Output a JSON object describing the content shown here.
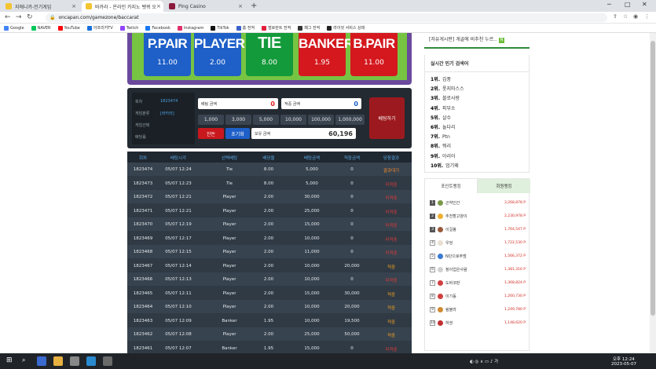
{
  "browser": {
    "tabs": [
      {
        "label": "지애니카-인기게임",
        "active": false,
        "color": "#f4c430"
      },
      {
        "label": "바카라 - 온라인 카지노 벳퀴 오",
        "active": true,
        "color": "#f4c430"
      },
      {
        "label": "Ping Casino",
        "active": false,
        "color": "#8b1a3c"
      }
    ],
    "url": "oncapan.com/gamezone/baccarat",
    "bookmarks": [
      {
        "label": "Google",
        "color": "#4285f4"
      },
      {
        "label": "NAVER",
        "color": "#03c75a"
      },
      {
        "label": "YouTube",
        "color": "#ff0000"
      },
      {
        "label": "아프리카TV",
        "color": "#1a6fd8"
      },
      {
        "label": "Twitch",
        "color": "#9146ff"
      },
      {
        "label": "Facebook",
        "color": "#1877f2"
      },
      {
        "label": "Instagram",
        "color": "#e1306c"
      },
      {
        "label": "TikTok",
        "color": "#111111"
      },
      {
        "label": "홈 전적",
        "color": "#3a63c8"
      },
      {
        "label": "벌로란트 전적",
        "color": "#e0203a"
      },
      {
        "label": "페그 전적",
        "color": "#333333"
      },
      {
        "label": "라이엇 서비스 상태",
        "color": "#222222"
      }
    ]
  },
  "bet_options": [
    {
      "name": "P.PAIR",
      "odds": "11.00",
      "color": "#1e5fc8"
    },
    {
      "name": "PLAYER",
      "odds": "2.00",
      "color": "#1e5fc8"
    },
    {
      "name": "TIE",
      "odds": "8.00",
      "color": "#139a3a"
    },
    {
      "name": "BANKER",
      "odds": "1.95",
      "color": "#d4181e"
    },
    {
      "name": "B.PAIR",
      "odds": "11.00",
      "color": "#d4181e"
    }
  ],
  "game_info": {
    "round_label": "회차",
    "round_value": "1823474",
    "type_label": "게임분류",
    "type_value": "[바카라]",
    "choice_label": "게임선택",
    "odds_label": "배당률"
  },
  "bet_panel": {
    "bet_amount_label": "베팅 금액",
    "bet_amount_value": "0",
    "win_amount_label": "적중 금액",
    "win_amount_value": "0",
    "chips": [
      "1,000",
      "3,000",
      "5,000",
      "10,000",
      "100,000",
      "1,000,000"
    ],
    "reset_label": "잔돈",
    "clear_label": "초기화",
    "balance_label": "보유 금액",
    "balance_value": "60,196",
    "submit_label": "베팅하기"
  },
  "history": {
    "headers": [
      "회차",
      "베팅시각",
      "선택베팅",
      "배당율",
      "베팅금액",
      "적중금액",
      "당첨결과"
    ],
    "rows": [
      [
        "1823474",
        "05/07 12:24",
        "Tie",
        "8.00",
        "5,000",
        "0",
        "결과대기",
        "wait"
      ],
      [
        "1823473",
        "05/07 12:23",
        "Tie",
        "8.00",
        "5,000",
        "0",
        "미적중",
        "lose"
      ],
      [
        "1823472",
        "05/07 12:21",
        "Player",
        "2.00",
        "30,000",
        "0",
        "미적중",
        "lose"
      ],
      [
        "1823471",
        "05/07 12:21",
        "Player",
        "2.00",
        "25,000",
        "0",
        "미적중",
        "lose"
      ],
      [
        "1823470",
        "05/07 12:19",
        "Player",
        "2.00",
        "15,000",
        "0",
        "미적중",
        "lose"
      ],
      [
        "1823469",
        "05/07 12:17",
        "Player",
        "2.00",
        "10,000",
        "0",
        "미적중",
        "lose"
      ],
      [
        "1823468",
        "05/07 12:15",
        "Player",
        "2.00",
        "11,000",
        "0",
        "미적중",
        "lose"
      ],
      [
        "1823467",
        "05/07 12:14",
        "Player",
        "2.00",
        "10,000",
        "20,000",
        "적중",
        "win"
      ],
      [
        "1823466",
        "05/07 12:13",
        "Player",
        "2.00",
        "10,000",
        "0",
        "미적중",
        "lose"
      ],
      [
        "1823465",
        "05/07 12:11",
        "Player",
        "2.00",
        "15,000",
        "30,000",
        "적중",
        "win"
      ],
      [
        "1823464",
        "05/07 12:10",
        "Player",
        "2.00",
        "10,000",
        "20,000",
        "적중",
        "win"
      ],
      [
        "1823463",
        "05/07 12:09",
        "Banker",
        "1.95",
        "10,000",
        "19,500",
        "적중",
        "win"
      ],
      [
        "1823462",
        "05/07 12:08",
        "Player",
        "2.00",
        "25,000",
        "50,000",
        "적중",
        "win"
      ],
      [
        "1823461",
        "05/07 12:07",
        "Banker",
        "1.95",
        "15,000",
        "0",
        "미적중",
        "lose"
      ]
    ]
  },
  "sidebar": {
    "notice": "[자유게시판] 게골에 비추천 누르..",
    "new_badge": "N",
    "popular_title": "실시간 인기 검색어",
    "keywords": [
      {
        "rank": "1위.",
        "word": "김풍"
      },
      {
        "rank": "2위.",
        "word": "풋지마스스"
      },
      {
        "rank": "3위.",
        "word": "블로사랑"
      },
      {
        "rank": "4위.",
        "word": "피부소"
      },
      {
        "rank": "5위.",
        "word": "살수"
      },
      {
        "rank": "6위.",
        "word": "놀다리"
      },
      {
        "rank": "7위.",
        "word": "Ptn"
      },
      {
        "rank": "8위.",
        "word": "뭐리"
      },
      {
        "rank": "9위.",
        "word": "아리아"
      },
      {
        "rank": "10위.",
        "word": "엄기왜"
      }
    ],
    "rank_tabs": [
      "포인트랭킹",
      "회원랭킹"
    ],
    "rankings": [
      {
        "no": "1",
        "name": "곤약인간",
        "points": "3,268,878 P",
        "avatar": "#7a9a4a"
      },
      {
        "no": "2",
        "name": "추천할고양이",
        "points": "2,230,978 P",
        "avatar": "#f0b030"
      },
      {
        "no": "3",
        "name": "이걸봉",
        "points": "1,764,547 P",
        "avatar": "#9a5a3a"
      },
      {
        "no": "4",
        "name": "우엉",
        "points": "1,722,530 P",
        "avatar": "#e8e0d0"
      },
      {
        "no": "5",
        "name": "N단으로주범",
        "points": "1,566,372 P",
        "avatar": "#3a7ad0"
      },
      {
        "no": "6",
        "name": "정이업은사람",
        "points": "1,381,316 P",
        "avatar": "#d0d0d0"
      },
      {
        "no": "7",
        "name": "도바코판",
        "points": "1,368,824 P",
        "avatar": "#d04040"
      },
      {
        "no": "8",
        "name": "이기동",
        "points": "1,260,730 P",
        "avatar": "#d04040"
      },
      {
        "no": "9",
        "name": "림볼라",
        "points": "1,249,780 P",
        "avatar": "#d08a30"
      },
      {
        "no": "10",
        "name": "하권",
        "points": "1,148,620 P",
        "avatar": "#c03030"
      }
    ]
  },
  "taskbar": {
    "time": "오후 12:24",
    "date": "2023-05-07"
  }
}
